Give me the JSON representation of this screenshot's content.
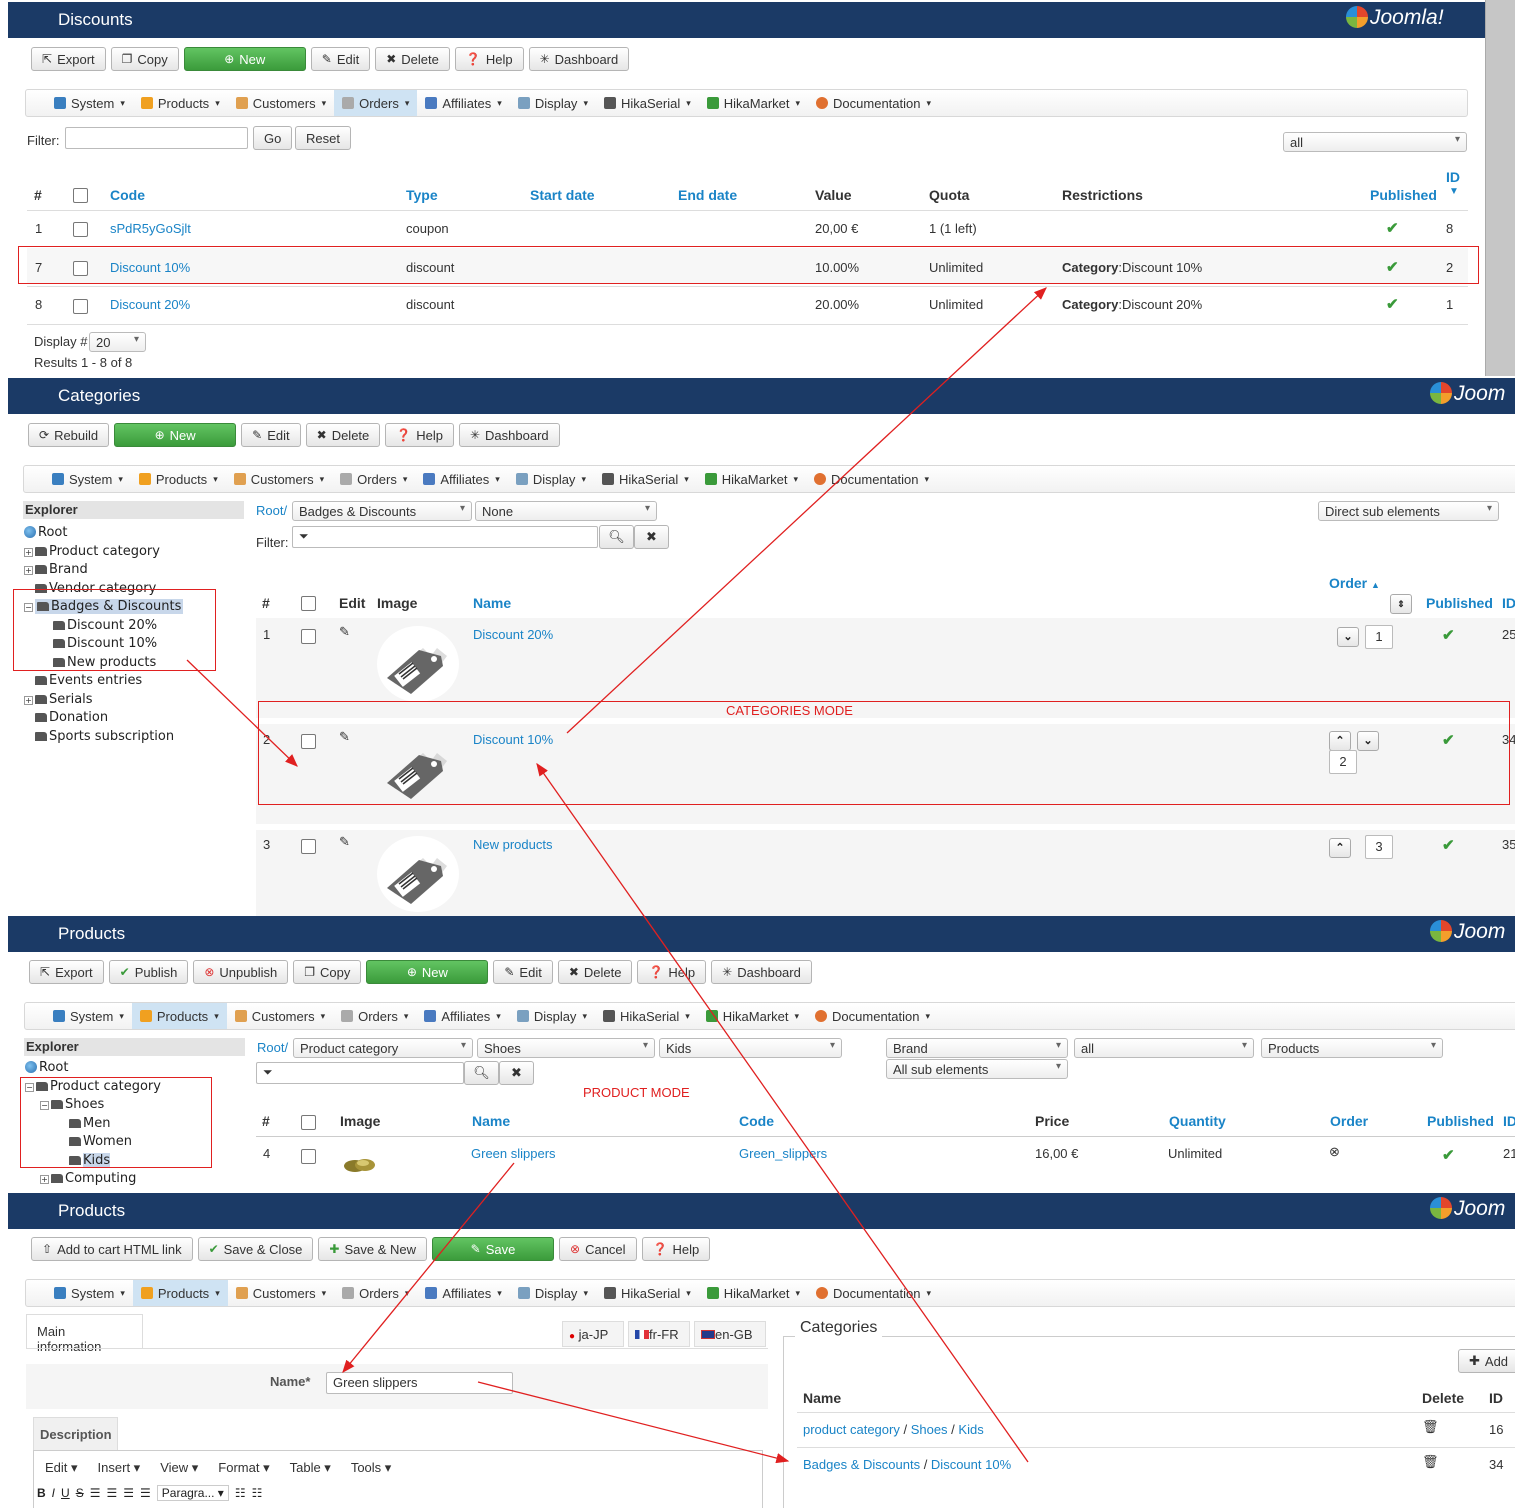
{
  "menu": [
    "System",
    "Products",
    "Customers",
    "Orders",
    "Affiliates",
    "Display",
    "HikaSerial",
    "HikaMarket",
    "Documentation"
  ],
  "logo": "Joomla!",
  "logo_cut": "Joom",
  "discounts": {
    "title": "Discounts",
    "toolbar": [
      "Export",
      "Copy",
      "New",
      "Edit",
      "Delete",
      "Help",
      "Dashboard"
    ],
    "filter_label": "Filter:",
    "go": "Go",
    "reset": "Reset",
    "select_all": "all",
    "columns": {
      "num": "#",
      "code": "Code",
      "type": "Type",
      "start": "Start date",
      "end": "End date",
      "value": "Value",
      "quota": "Quota",
      "restrictions": "Restrictions",
      "published": "Published",
      "id": "ID"
    },
    "rows": [
      {
        "num": "1",
        "code": "sPdR5yGoSjlt",
        "type": "coupon",
        "value": "20,00 €",
        "quota": "1 (1 left)",
        "restr_label": "",
        "restr_value": "",
        "id": "8"
      },
      {
        "num": "7",
        "code": "Discount 10%",
        "type": "discount",
        "value": "10.00%",
        "quota": "Unlimited",
        "restr_label": "Category",
        "restr_value": ":Discount 10%",
        "id": "2"
      },
      {
        "num": "8",
        "code": "Discount 20%",
        "type": "discount",
        "value": "20.00%",
        "quota": "Unlimited",
        "restr_label": "Category",
        "restr_value": ":Discount 20%",
        "id": "1"
      }
    ],
    "display_label": "Display #",
    "display_value": "20",
    "results": "Results 1 - 8 of 8"
  },
  "categories": {
    "title": "Categories",
    "toolbar": [
      "Rebuild",
      "New",
      "Edit",
      "Delete",
      "Help",
      "Dashboard"
    ],
    "explorer": "Explorer",
    "tree": [
      "Root",
      "Product category",
      "Brand",
      "Vendor category",
      "Badges & Discounts",
      "Discount 20%",
      "Discount 10%",
      "New products",
      "Events entries",
      "Serials",
      "Donation",
      "Sports subscription"
    ],
    "root_link": "Root/",
    "sel1": "Badges & Discounts",
    "sel2": "None",
    "sel3": "Direct sub elements",
    "filter_label": "Filter:",
    "columns": {
      "num": "#",
      "edit": "Edit",
      "image": "Image",
      "name": "Name",
      "order": "Order",
      "published": "Published",
      "id": "ID"
    },
    "rows": [
      {
        "num": "1",
        "name": "Discount 20%",
        "order": "1",
        "id": "25"
      },
      {
        "num": "2",
        "name": "Discount 10%",
        "order": "2",
        "id": "34"
      },
      {
        "num": "3",
        "name": "New products",
        "order": "3",
        "id": "35"
      }
    ],
    "mode_label": "CATEGORIES MODE"
  },
  "products": {
    "title": "Products",
    "toolbar": [
      "Export",
      "Publish",
      "Unpublish",
      "Copy",
      "New",
      "Edit",
      "Delete",
      "Help",
      "Dashboard"
    ],
    "explorer": "Explorer",
    "tree": [
      "Root",
      "Product category",
      "Shoes",
      "Men",
      "Women",
      "Kids",
      "Computing"
    ],
    "root_link": "Root/",
    "sel1": "Product category",
    "sel2": "Shoes",
    "sel3": "Kids",
    "sel4": "Brand",
    "sel5": "all",
    "sel6": "Products",
    "sel7": "All sub elements",
    "columns": {
      "num": "#",
      "image": "Image",
      "name": "Name",
      "code": "Code",
      "price": "Price",
      "quantity": "Quantity",
      "order": "Order",
      "published": "Published",
      "id": "ID"
    },
    "row": {
      "num": "4",
      "name": "Green slippers",
      "code": "Green_slippers",
      "price": "16,00 €",
      "quantity": "Unlimited",
      "id": "21"
    },
    "mode_label": "PRODUCT MODE"
  },
  "product_edit": {
    "title": "Products",
    "toolbar": [
      "Add to cart HTML link",
      "Save & Close",
      "Save & New",
      "Save",
      "Cancel",
      "Help"
    ],
    "tab_main": "Main information",
    "langs": [
      "ja-JP",
      "fr-FR",
      "en-GB"
    ],
    "name_label": "Name*",
    "name_value": "Green slippers",
    "description": "Description",
    "editor_menu": [
      "Edit",
      "Insert",
      "View",
      "Format",
      "Table",
      "Tools"
    ],
    "paragraph": "Paragra...",
    "categories_legend": "Categories",
    "add": "Add",
    "cat_columns": {
      "name": "Name",
      "delete": "Delete",
      "id": "ID"
    },
    "cat_rows": [
      {
        "parts": [
          "product category",
          "Shoes",
          "Kids"
        ],
        "id": "16"
      },
      {
        "parts": [
          "Badges & Discounts",
          "Discount 10%"
        ],
        "id": "34"
      }
    ]
  }
}
